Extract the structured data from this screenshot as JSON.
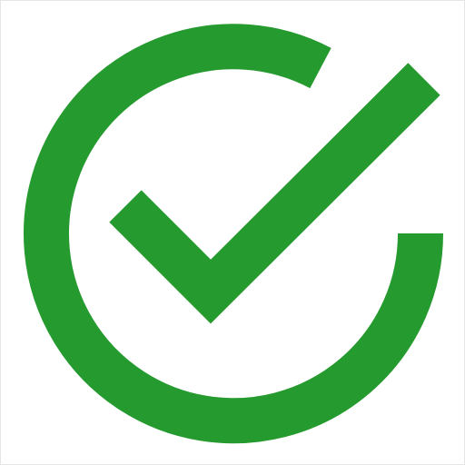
{
  "icon": {
    "name": "check-circle-icon",
    "color": "#259a2f",
    "background": "#ffffff"
  }
}
